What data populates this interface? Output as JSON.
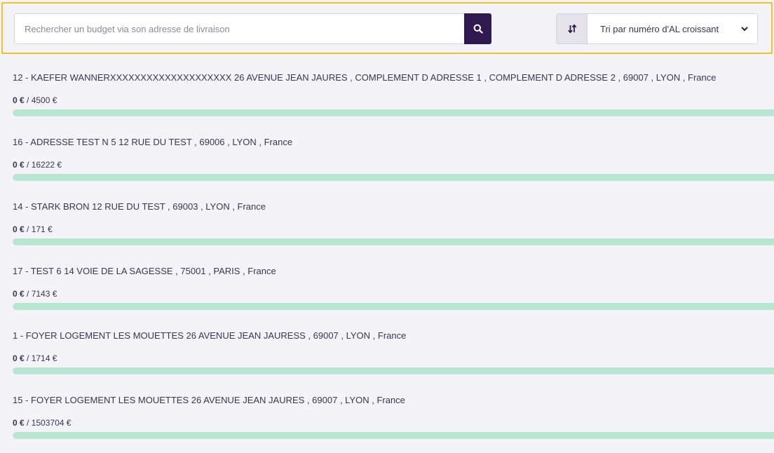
{
  "search": {
    "placeholder": "Rechercher un budget via son adresse de livraison",
    "value": "",
    "button_icon": "search-icon"
  },
  "sort": {
    "toggle_icon": "sort-arrows-icon",
    "selected": "Tri par numéro d'AL croissant",
    "dropdown_icon": "chevron-down-icon"
  },
  "colors": {
    "accent": "#2e1a4e",
    "highlight_border": "#f3c12c",
    "progress_track": "#b9e5d3",
    "progress_fill": "#34b37a",
    "background": "#f4f3f8"
  },
  "budgets": [
    {
      "address": "12 -  KAEFER WANNERXXXXXXXXXXXXXXXXXXXX  26 AVENUE JEAN JAURES , COMPLEMENT D ADRESSE 1 , COMPLEMENT D ADRESSE 2 , 69007 , LYON , France",
      "spent": "0 €",
      "total": "/ 4500 €",
      "progress": 0
    },
    {
      "address": "16 -  ADRESSE TEST N 5  12 RUE DU TEST , 69006 , LYON , France",
      "spent": "0 €",
      "total": "/ 16222 €",
      "progress": 0
    },
    {
      "address": "14 -  STARK BRON  12 RUE DU TEST , 69003 , LYON , France",
      "spent": "0 €",
      "total": "/ 171 €",
      "progress": 0
    },
    {
      "address": "17 -  TEST 6  14 VOIE DE LA SAGESSE , 75001 , PARIS , France",
      "spent": "0 €",
      "total": "/ 7143 €",
      "progress": 0
    },
    {
      "address": "1 -  FOYER LOGEMENT LES MOUETTES  26 AVENUE JEAN JAURESS , 69007 , LYON , France",
      "spent": "0 €",
      "total": "/ 1714 €",
      "progress": 0
    },
    {
      "address": "15 -  FOYER LOGEMENT LES MOUETTES  26 AVENUE JEAN JAURES , 69007 , LYON , France",
      "spent": "0 €",
      "total": "/ 1503704 €",
      "progress": 0
    }
  ]
}
